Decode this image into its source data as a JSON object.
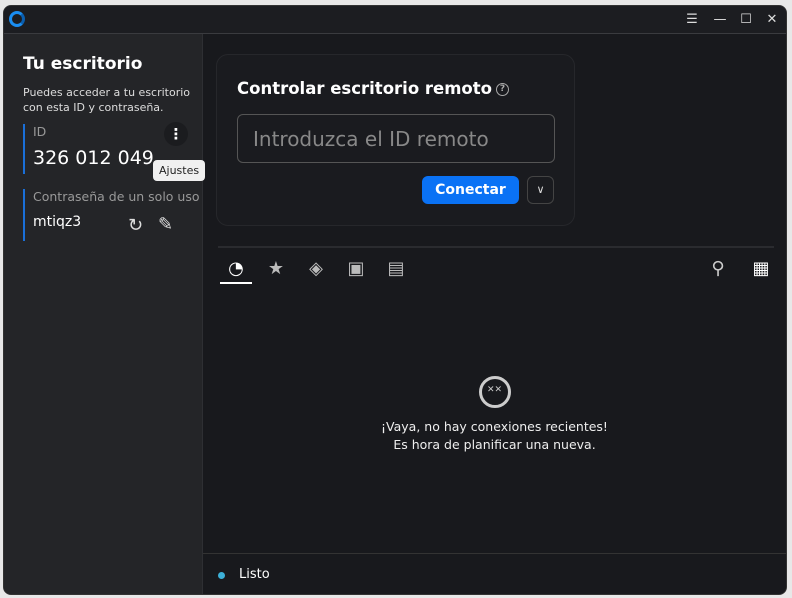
{
  "titlebar": {
    "icons": [
      "rustdesk-logo",
      "menu-icon",
      "minimize-icon",
      "maximize-icon",
      "close-icon"
    ]
  },
  "sidebar": {
    "title": "Tu escritorio",
    "description": "Puedes acceder a tu escritorio con esta ID y contraseña.",
    "id_label": "ID",
    "id_value": "326 012 049",
    "tooltip": "Ajustes",
    "password_label": "Contraseña de un solo uso",
    "password_value": "mtiqz3"
  },
  "connect": {
    "title": "Controlar escritorio remoto",
    "placeholder": "Introduzca el ID remoto",
    "button": "Conectar"
  },
  "tabs": [
    {
      "icon": "clock-icon",
      "active": true
    },
    {
      "icon": "star-icon"
    },
    {
      "icon": "compass-icon"
    },
    {
      "icon": "address-book-icon"
    },
    {
      "icon": "devices-icon"
    }
  ],
  "empty": {
    "line1": "¡Vaya, no hay conexiones recientes!",
    "line2": "Es hora de planificar una nueva."
  },
  "status": {
    "text": "Listo",
    "color": "#3cb0d8"
  },
  "colors": {
    "accent": "#0a72f5",
    "sidebar": "#242528",
    "main": "#18191d"
  }
}
